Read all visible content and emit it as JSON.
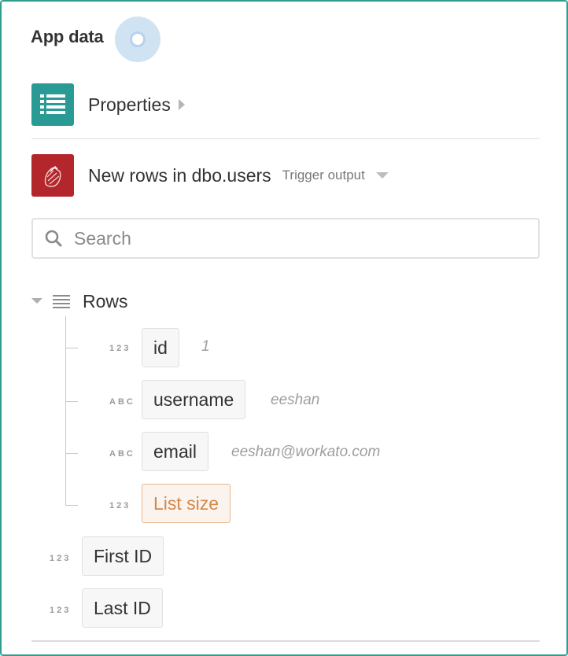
{
  "panel": {
    "title": "App data"
  },
  "sources": [
    {
      "label": "Properties",
      "icon": "list-icon",
      "color": "#2a9a95"
    },
    {
      "label": "New rows in dbo.users",
      "sub_label": "Trigger output",
      "icon": "sql-server-icon",
      "color": "#b3262b"
    }
  ],
  "search": {
    "placeholder": "Search",
    "value": ""
  },
  "tree": {
    "group_label": "Rows",
    "fields": [
      {
        "type": "123",
        "name": "id",
        "sample": "1"
      },
      {
        "type": "ABC",
        "name": "username",
        "sample": "eeshan"
      },
      {
        "type": "ABC",
        "name": "email",
        "sample": "eeshan@workato.com"
      },
      {
        "type": "123",
        "name": "List size",
        "sample": ""
      }
    ],
    "top_fields": [
      {
        "type": "123",
        "name": "First ID"
      },
      {
        "type": "123",
        "name": "Last ID"
      }
    ]
  },
  "colors": {
    "panel_border": "#2f9e8f",
    "active_pill_text": "#d3884b",
    "active_pill_border": "#e9b58a"
  }
}
